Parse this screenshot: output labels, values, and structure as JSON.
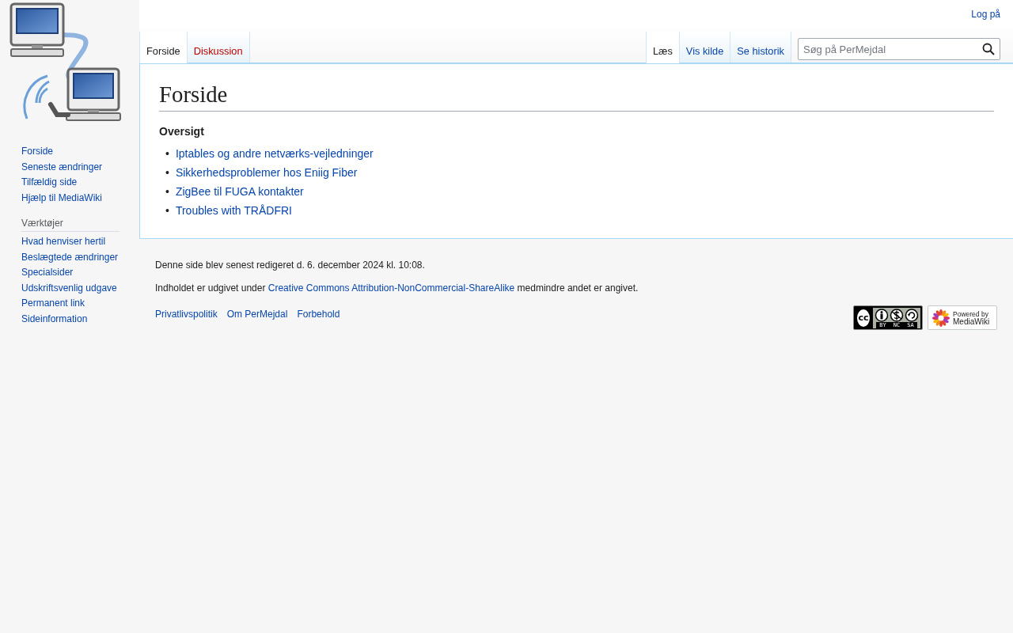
{
  "user_links": [
    {
      "label": "Log på"
    }
  ],
  "sidebar": {
    "navigation": [
      "Forside",
      "Seneste ændringer",
      "Tilfældig side",
      "Hjælp til MediaWiki"
    ],
    "tools": {
      "heading": "Værktøjer",
      "items": [
        "Hvad henviser hertil",
        "Beslægtede ændringer",
        "Specialsider",
        "Udskriftsvenlig udgave",
        "Permanent link",
        "Sideinformation"
      ]
    }
  },
  "tabs_left": [
    {
      "label": "Forside",
      "selected": true,
      "missing": false
    },
    {
      "label": "Diskussion",
      "selected": false,
      "missing": true
    }
  ],
  "tabs_right": [
    {
      "label": "Læs",
      "selected": true
    },
    {
      "label": "Vis kilde",
      "selected": false
    },
    {
      "label": "Se historik",
      "selected": false
    }
  ],
  "search": {
    "placeholder": "Søg på PerMejdal"
  },
  "content": {
    "title": "Forside",
    "heading": "Oversigt",
    "links": [
      {
        "marker": "•",
        "label": "Iptables og andre netværks-vejledninger"
      },
      {
        "marker": "•",
        "label": "Sikkerhedsproblemer hos Eniig Fiber"
      },
      {
        "marker": "•",
        "label": "ZigBee til FUGA kontakter"
      },
      {
        "marker": "•",
        "label": "Troubles with TRÅDFRI"
      }
    ]
  },
  "footer": {
    "last_modified": "Denne side blev senest redigeret d. 6. december 2024 kl. 10:08.",
    "license_before": "Indholdet er udgivet under",
    "license_link": "Creative Commons Attribution-NonCommercial-ShareAlike",
    "license_after": "medmindre andet er angivet.",
    "links": [
      "Privatlivspolitik",
      "Om PerMejdal",
      "Forbehold"
    ],
    "cc_badge": {
      "symbol": "cc",
      "labels": [
        "BY",
        "NC",
        "SA"
      ]
    },
    "powered_badge": {
      "line_1": "Powered by",
      "line_2": "MediaWiki"
    }
  }
}
